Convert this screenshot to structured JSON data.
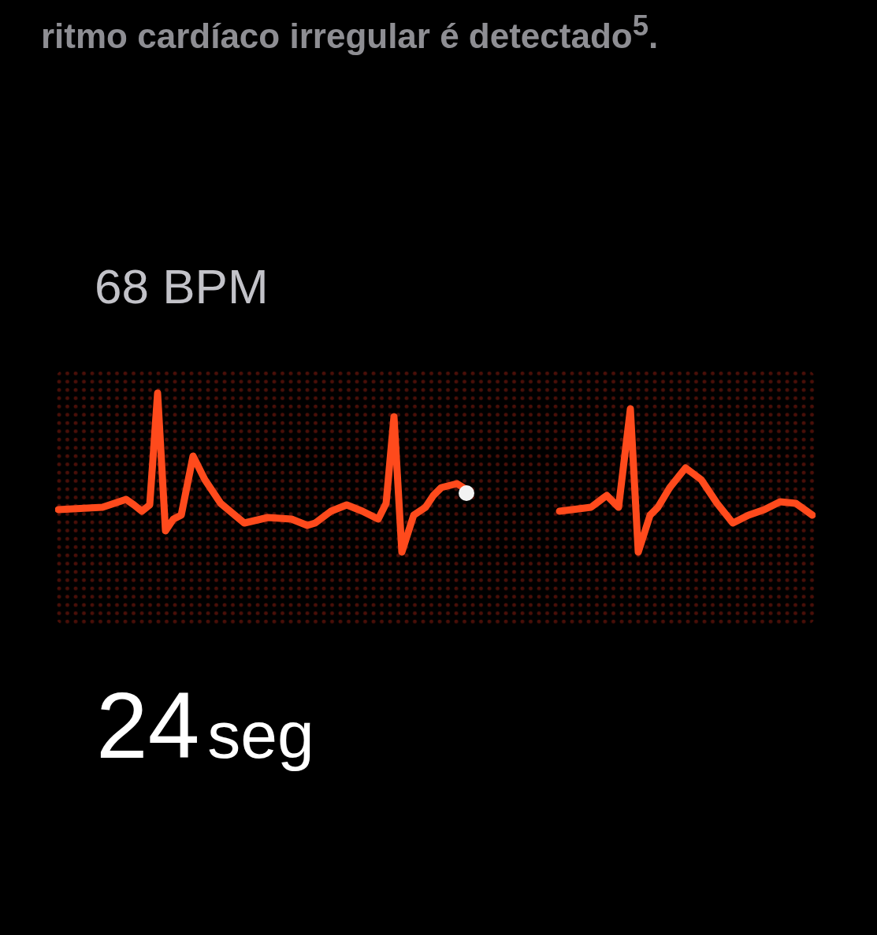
{
  "intro_text": "ritmo cardíaco irregular é detectado$^{5}$.",
  "heart_rate": "68 BPM",
  "countdown": {
    "value": "24",
    "unit": "seg"
  }
}
